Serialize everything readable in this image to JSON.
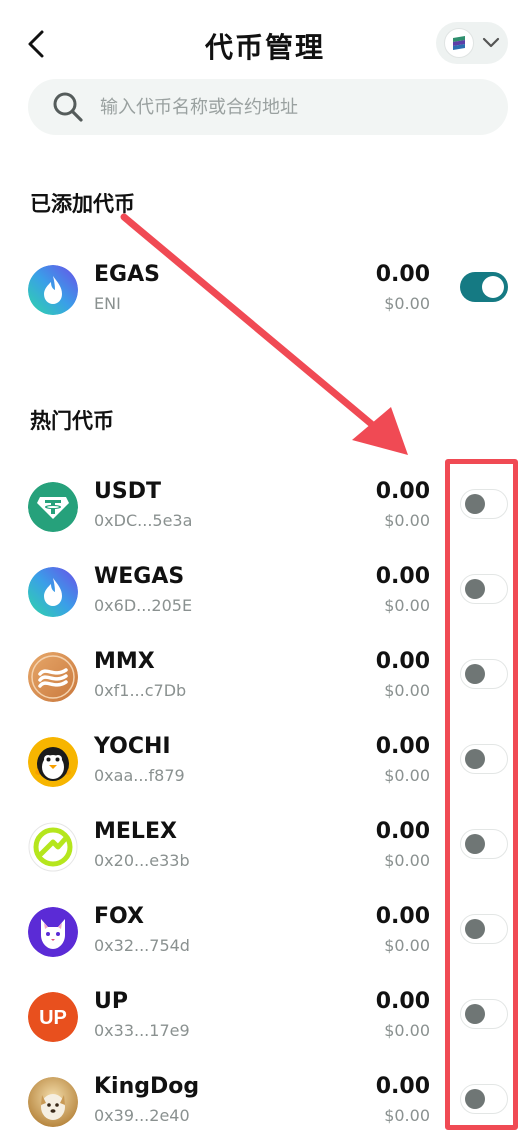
{
  "header": {
    "title": "代币管理",
    "back_icon": "chevron-left-icon",
    "network_icon": "layers-icon",
    "dropdown_icon": "chevron-down-icon"
  },
  "search": {
    "placeholder": "输入代币名称或合约地址",
    "value": ""
  },
  "added_section": {
    "title": "已添加代币",
    "tokens": [
      {
        "symbol": "EGAS",
        "sub": "ENI",
        "amount": "0.00",
        "value": "$0.00",
        "enabled": true
      }
    ]
  },
  "hot_section": {
    "title": "热门代币",
    "tokens": [
      {
        "symbol": "USDT",
        "sub": "0xDC...5e3a",
        "amount": "0.00",
        "value": "$0.00",
        "enabled": false
      },
      {
        "symbol": "WEGAS",
        "sub": "0x6D...205E",
        "amount": "0.00",
        "value": "$0.00",
        "enabled": false
      },
      {
        "symbol": "MMX",
        "sub": "0xf1...c7Db",
        "amount": "0.00",
        "value": "$0.00",
        "enabled": false
      },
      {
        "symbol": "YOCHI",
        "sub": "0xaa...f879",
        "amount": "0.00",
        "value": "$0.00",
        "enabled": false
      },
      {
        "symbol": "MELEX",
        "sub": "0x20...e33b",
        "amount": "0.00",
        "value": "$0.00",
        "enabled": false
      },
      {
        "symbol": "FOX",
        "sub": "0x32...754d",
        "amount": "0.00",
        "value": "$0.00",
        "enabled": false
      },
      {
        "symbol": "UP",
        "sub": "0x33...17e9",
        "amount": "0.00",
        "value": "$0.00",
        "enabled": false
      },
      {
        "symbol": "KingDog",
        "sub": "0x39...2e40",
        "amount": "0.00",
        "value": "$0.00",
        "enabled": false
      }
    ]
  },
  "logos": {
    "up_text": "UP"
  },
  "colors": {
    "accent": "#157a83",
    "annotation": "#f04a54",
    "usdt": "#26a17b",
    "up": "#e8501e"
  }
}
